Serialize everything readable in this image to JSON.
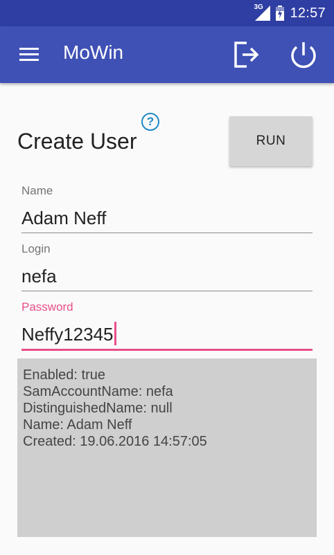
{
  "statusbar": {
    "network": "3G",
    "time": "12:57"
  },
  "appbar": {
    "title": "MoWin",
    "icons": [
      "menu-icon",
      "logout-icon",
      "power-icon"
    ]
  },
  "page": {
    "title": "Create User",
    "help_symbol": "?",
    "run_label": "RUN"
  },
  "form": {
    "name_label": "Name",
    "name_value": "Adam Neff",
    "login_label": "Login",
    "login_value": "nefa",
    "password_label": "Password",
    "password_value": "Neffy12345"
  },
  "output": {
    "lines": [
      "Enabled: true",
      "SamAccountName: nefa",
      "DistinguishedName: null",
      "Name: Adam Neff",
      "Created: 19.06.2016 14:57:05"
    ]
  },
  "colors": {
    "statusbar": "#2f3ea3",
    "appbar": "#3f51b5",
    "accent": "#e94e89",
    "help": "#1e88c8",
    "output_bg": "#cfcfcf"
  }
}
